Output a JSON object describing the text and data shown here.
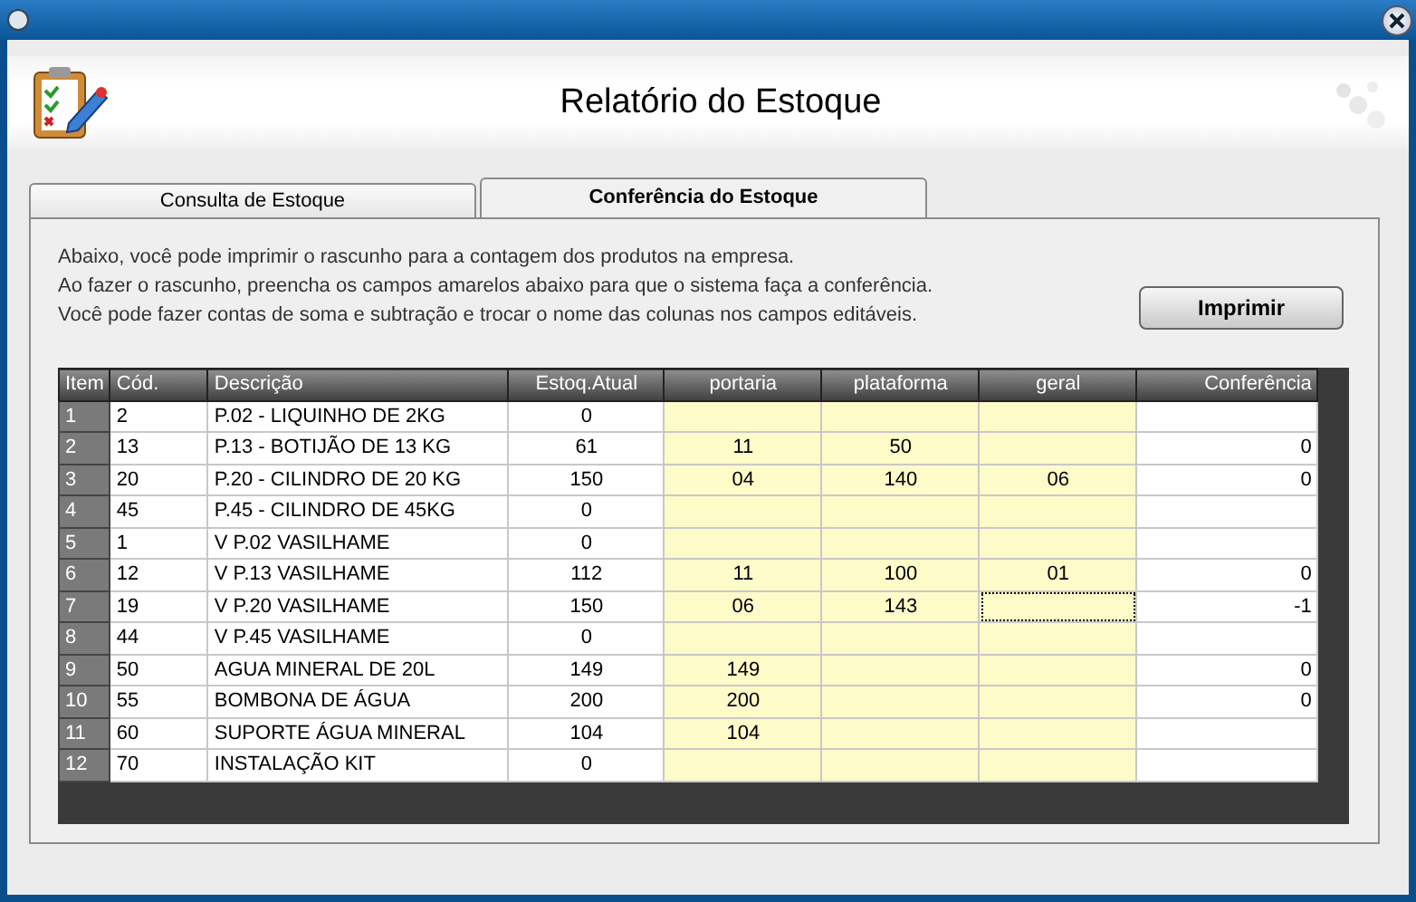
{
  "window": {
    "title": "Relatório do Estoque"
  },
  "tabs": [
    {
      "label": "Consulta de Estoque",
      "selected": false
    },
    {
      "label": "Conferência do Estoque",
      "selected": true
    }
  ],
  "instructions": [
    "Abaixo, você pode imprimir o rascunho para a contagem dos produtos na empresa.",
    "Ao fazer o rascunho, preencha os campos amarelos abaixo para que o sistema faça a conferência.",
    "Você pode fazer contas de soma e subtração e trocar o nome das colunas nos campos editáveis."
  ],
  "print_button": "Imprimir",
  "table": {
    "columns": [
      {
        "label": "Item",
        "kind": "index"
      },
      {
        "label": "Cód.",
        "kind": "text"
      },
      {
        "label": "Descrição",
        "kind": "text"
      },
      {
        "label": "Estoq.Atual",
        "kind": "number"
      },
      {
        "label": "portaria",
        "kind": "entry"
      },
      {
        "label": "plataforma",
        "kind": "entry"
      },
      {
        "label": "geral",
        "kind": "entry"
      },
      {
        "label": "Conferência",
        "kind": "result"
      }
    ],
    "rows": [
      {
        "cells": [
          "1",
          "2",
          "P.02 - LIQUINHO DE 2KG",
          "0",
          null,
          null,
          null,
          null
        ],
        "geral_focused": false
      },
      {
        "cells": [
          "2",
          "13",
          "P.13 - BOTIJÃO DE 13 KG",
          "61",
          "11",
          "50",
          null,
          "0"
        ],
        "geral_focused": false
      },
      {
        "cells": [
          "3",
          "20",
          "P.20 - CILINDRO DE 20 KG",
          "150",
          "04",
          "140",
          "06",
          "0"
        ],
        "geral_focused": false
      },
      {
        "cells": [
          "4",
          "45",
          "P.45 - CILINDRO DE 45KG",
          "0",
          null,
          null,
          null,
          null
        ],
        "geral_focused": false
      },
      {
        "cells": [
          "5",
          "1",
          "V P.02 VASILHAME",
          "0",
          null,
          null,
          null,
          null
        ],
        "geral_focused": false
      },
      {
        "cells": [
          "6",
          "12",
          "V P.13 VASILHAME",
          "112",
          "11",
          "100",
          "01",
          "0"
        ],
        "geral_focused": false
      },
      {
        "cells": [
          "7",
          "19",
          "V P.20 VASILHAME",
          "150",
          "06",
          "143",
          null,
          "-1"
        ],
        "geral_focused": true
      },
      {
        "cells": [
          "8",
          "44",
          "V P.45 VASILHAME",
          "0",
          null,
          null,
          null,
          null
        ],
        "geral_focused": false
      },
      {
        "cells": [
          "9",
          "50",
          "AGUA MINERAL DE 20L",
          "149",
          "149",
          null,
          null,
          "0"
        ],
        "geral_focused": false
      },
      {
        "cells": [
          "10",
          "55",
          "BOMBONA DE ÁGUA",
          "200",
          "200",
          null,
          null,
          "0"
        ],
        "geral_focused": false
      },
      {
        "cells": [
          "11",
          "60",
          "SUPORTE ÁGUA MINERAL",
          "104",
          "104",
          null,
          null,
          null
        ],
        "geral_focused": false
      },
      {
        "cells": [
          "12",
          "70",
          "INSTALAÇÃO KIT",
          "0",
          null,
          null,
          null,
          null
        ],
        "geral_focused": false
      }
    ]
  }
}
